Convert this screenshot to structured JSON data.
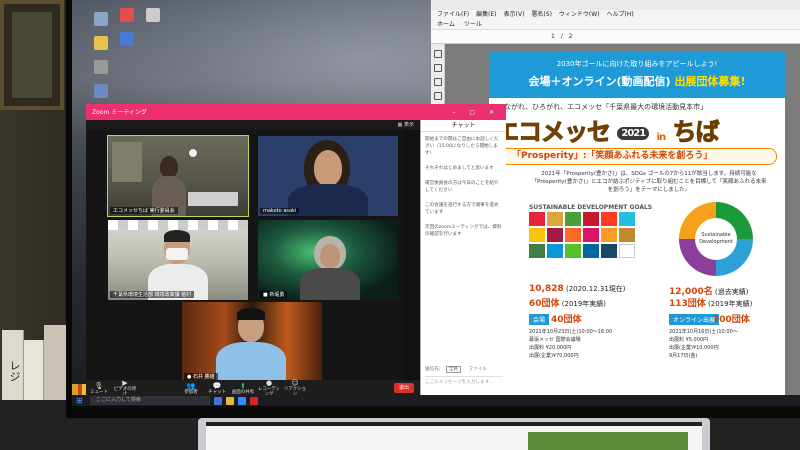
{
  "desktop": {
    "icons": [
      {
        "label": "",
        "icon": "recycle-bin-icon",
        "color": "#8aa6c8"
      },
      {
        "label": "",
        "icon": "app-icon",
        "color": "#e44d4d"
      },
      {
        "label": "",
        "icon": "app-icon",
        "color": "#cccccc"
      },
      {
        "label": "",
        "icon": "folder-icon",
        "color": "#e8c24a"
      },
      {
        "label": "",
        "icon": "app-icon",
        "color": "#4a7ad8"
      }
    ],
    "taskbar": {
      "search_placeholder": "ここに入力して検索"
    }
  },
  "pdf_viewer": {
    "menu": [
      "ファイル(F)",
      "編集(E)",
      "表示(V)",
      "署名(S)",
      "ウィンドウ(W)",
      "ヘルプ(H)"
    ],
    "tabs": [
      "ホーム",
      "ツール"
    ],
    "page_indicator": "1 / 2",
    "zoom": "",
    "document": {
      "banner_line1": "2030年ゴールに向けた取り組みをアピールしよう!",
      "banner_line2_left": "会場＋オンライン(動画配信)",
      "banner_line2_right": "出展団体募集!",
      "tagline": "つながれ、ひろがれ、エコメッセ「千葉県最大の環境活動見本市」",
      "title_main": "エコメッセ",
      "title_year": "2021",
      "title_in": "in",
      "title_city": "ちば",
      "prosperity": "「Prosperity」:「笑顔あふれる未来を創ろう」",
      "intro": "2021年「Prosperity(豊かさ)」は、SDGs ゴールの7から11が該当します。持続可能な「Prosperity(豊かさ)」とエコが結ぶポジティブに取り組むことを目標して「笑顔あふれる未来を創ろう」をテーマにしました。",
      "sdg_label": "SUSTAINABLE DEVELOPMENT GOALS",
      "wheel_text": "Sustainable Development",
      "stats": [
        {
          "value": "10,828",
          "note": "(2020.12.31現在)"
        },
        {
          "value": "12,000名",
          "note": "(過去実績)"
        },
        {
          "value": "60団体",
          "note": "(2019年実績)"
        },
        {
          "value": "113団体",
          "note": "(2019年実績)"
        }
      ],
      "section_venue": "会場",
      "venue_count": "40団体",
      "section_online": "オンライン出展",
      "online_count": "100団体",
      "venue_lines": [
        "2021年10月23日(土)10:00〜16:00",
        "幕張メッセ 国際会議場",
        "出展料 ¥20,000円",
        "出展(企業)¥70,000円"
      ],
      "online_lines": [
        "2021年10月16日(土)10:00〜",
        "出展料 ¥5,000円",
        "出展(企業)¥10,000円",
        "9月17日(金)"
      ]
    }
  },
  "zoom": {
    "window_title": "Zoom ミーティング",
    "view_label": "表示",
    "time": "",
    "participants": [
      {
        "name": "エコメッセちば 実行委員会"
      },
      {
        "name": "makoto asaki"
      },
      {
        "name": "千葉県環境生活部 環境政策課 植村"
      },
      {
        "name": "■ 新堀勇"
      },
      {
        "name": "● 石井 勝雄"
      }
    ],
    "chat": {
      "title": "チャット",
      "messages": [
        "開始までの間はご自由にお話しください（15:00になりしたら開始します）",
        "それぞれはじめましてと思います",
        "運営委員会の方は今日のことを紹介してください",
        "この会議を進行する方で議事を進めています",
        "次回のzoomミーティングでは、資料の確認を行います"
      ],
      "to_label": "送信先:",
      "to_value": "全員",
      "file_label": "ファイル",
      "input_placeholder": "ここにメッセージを入力します..."
    },
    "controls": [
      {
        "label": "ミュート",
        "icon": "mic-icon"
      },
      {
        "label": "ビデオの停止",
        "icon": "video-icon"
      },
      {
        "label": "参加者",
        "icon": "participants-icon"
      },
      {
        "label": "チャット",
        "icon": "chat-icon"
      },
      {
        "label": "画面の共有",
        "icon": "share-icon"
      },
      {
        "label": "レコーディング",
        "icon": "record-icon"
      },
      {
        "label": "リアクション",
        "icon": "reaction-icon"
      }
    ],
    "leave_label": "退出"
  },
  "book_spine_text": "レジ"
}
